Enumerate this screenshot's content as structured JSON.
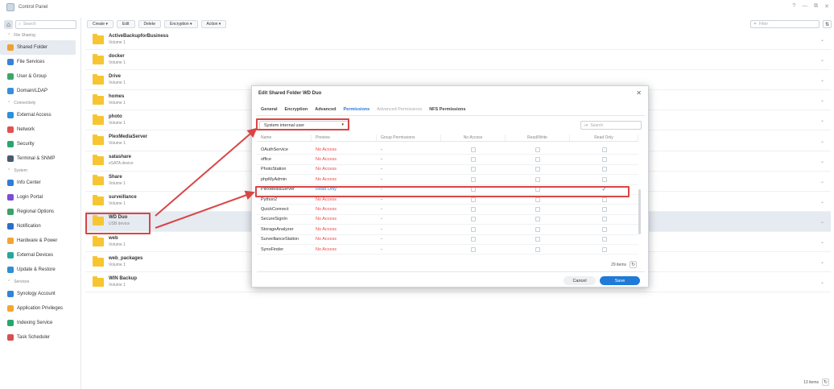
{
  "window": {
    "title": "Control Panel",
    "controls": [
      "?",
      "—",
      "⧉",
      "✕"
    ]
  },
  "sidebar": {
    "search_placeholder": "Search",
    "sections": [
      {
        "label": "File Sharing",
        "items": [
          {
            "label": "Shared Folder",
            "icon": "shared-folder-icon",
            "color": "#f0a030",
            "active": true
          },
          {
            "label": "File Services",
            "icon": "file-services-icon",
            "color": "#3b82d6"
          },
          {
            "label": "User & Group",
            "icon": "user-group-icon",
            "color": "#3ea66b"
          },
          {
            "label": "Domain/LDAP",
            "icon": "domain-icon",
            "color": "#3a8fd9"
          }
        ]
      },
      {
        "label": "Connectivity",
        "items": [
          {
            "label": "External Access",
            "icon": "external-access-icon",
            "color": "#2e8fdc"
          },
          {
            "label": "Network",
            "icon": "network-icon",
            "color": "#e05050"
          },
          {
            "label": "Security",
            "icon": "security-icon",
            "color": "#2aa56e"
          },
          {
            "label": "Terminal & SNMP",
            "icon": "terminal-icon",
            "color": "#485a6e"
          }
        ]
      },
      {
        "label": "System",
        "items": [
          {
            "label": "Info Center",
            "icon": "info-icon",
            "color": "#2e7fd4"
          },
          {
            "label": "Login Portal",
            "icon": "login-portal-icon",
            "color": "#7c4dd6"
          },
          {
            "label": "Regional Options",
            "icon": "regional-icon",
            "color": "#39a36a"
          },
          {
            "label": "Notification",
            "icon": "notification-icon",
            "color": "#2d6fc8"
          },
          {
            "label": "Hardware & Power",
            "icon": "hardware-icon",
            "color": "#f2a531"
          },
          {
            "label": "External Devices",
            "icon": "external-devices-icon",
            "color": "#2aa59a"
          },
          {
            "label": "Update & Restore",
            "icon": "update-icon",
            "color": "#2f8fd0"
          }
        ]
      },
      {
        "label": "Services",
        "items": [
          {
            "label": "Synology Account",
            "icon": "account-icon",
            "color": "#2f86d6"
          },
          {
            "label": "Application Privileges",
            "icon": "lock-icon",
            "color": "#f0a830"
          },
          {
            "label": "Indexing Service",
            "icon": "indexing-icon",
            "color": "#2aa56e"
          },
          {
            "label": "Task Scheduler",
            "icon": "calendar-icon",
            "color": "#d65050"
          }
        ]
      }
    ]
  },
  "toolbar": {
    "create": "Create ▾",
    "edit": "Edit",
    "delete": "Delete",
    "encryption": "Encryption ▾",
    "action": "Action ▾",
    "filter_placeholder": "Filter"
  },
  "folders": [
    {
      "name": "ActiveBackupforBusiness",
      "volume": "Volume 1"
    },
    {
      "name": "docker",
      "volume": "Volume 1"
    },
    {
      "name": "Drive",
      "volume": "Volume 1"
    },
    {
      "name": "homes",
      "volume": "Volume 1"
    },
    {
      "name": "photo",
      "volume": "Volume 1"
    },
    {
      "name": "PlexMediaServer",
      "volume": "Volume 1"
    },
    {
      "name": "satashare",
      "volume": "eSATA device"
    },
    {
      "name": "Share",
      "volume": "Volume 1"
    },
    {
      "name": "surveillance",
      "volume": "Volume 1"
    },
    {
      "name": "WD Duo",
      "volume": "USB device",
      "selected": true
    },
    {
      "name": "web",
      "volume": "Volume 1"
    },
    {
      "name": "web_packages",
      "volume": "Volume 1"
    },
    {
      "name": "WIN Backup",
      "volume": "Volume 1"
    }
  ],
  "footer": {
    "count": "13 items"
  },
  "dialog": {
    "title": "Edit Shared Folder WD Duo",
    "tabs": [
      "General",
      "Encryption",
      "Advanced",
      "Permissions",
      "Advanced Permissions",
      "NFS Permissions"
    ],
    "active_tab": "Permissions",
    "user_type": "System internal user",
    "search_placeholder": "Search",
    "columns": [
      "Name",
      "Preview",
      "Group Permissions",
      "No Access",
      "Read/Write",
      "Read Only"
    ],
    "rows": [
      {
        "name": "OAuthService",
        "preview": "No Access",
        "group": "-",
        "ro": false
      },
      {
        "name": "office",
        "preview": "No Access",
        "group": "-",
        "ro": false
      },
      {
        "name": "PhotoStation",
        "preview": "No Access",
        "group": "-",
        "ro": false
      },
      {
        "name": "phpMyAdmin",
        "preview": "No Access",
        "group": "-",
        "ro": false
      },
      {
        "name": "PlexMediaServer",
        "preview": "Read Only",
        "group": "-",
        "ro": true
      },
      {
        "name": "Python2",
        "preview": "No Access",
        "group": "-",
        "ro": false
      },
      {
        "name": "QuickConnect",
        "preview": "No Access",
        "group": "-",
        "ro": false
      },
      {
        "name": "SecureSignIn",
        "preview": "No Access",
        "group": "-",
        "ro": false
      },
      {
        "name": "StorageAnalyzer",
        "preview": "No Access",
        "group": "-",
        "ro": false
      },
      {
        "name": "SurveillanceStation",
        "preview": "No Access",
        "group": "-",
        "ro": false
      },
      {
        "name": "SynoFinder",
        "preview": "No Access",
        "group": "-",
        "ro": false
      }
    ],
    "count": "29 items",
    "cancel": "Cancel",
    "save": "Save"
  }
}
